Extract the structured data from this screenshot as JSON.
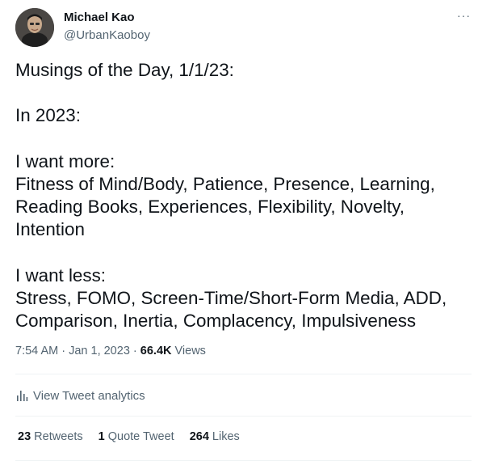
{
  "author": {
    "name": "Michael Kao",
    "handle": "@UrbanKaoboy"
  },
  "more_label": "···",
  "tweet": {
    "lines": [
      "Musings of the Day, 1/1/23:",
      "",
      "In 2023:",
      "",
      "I want more:",
      "Fitness of Mind/Body, Patience, Presence, Learning,",
      "Reading Books, Experiences, Flexibility, Novelty,",
      "Intention",
      "",
      "I want less:",
      "Stress, FOMO, Screen-Time/Short-Form Media, ADD,",
      "Comparison, Inertia, Complacency, Impulsiveness"
    ]
  },
  "meta": {
    "time": "7:54 AM",
    "sep1": " · ",
    "date": "Jan 1, 2023",
    "sep2": " · ",
    "views_count": "66.4K",
    "views_label": " Views"
  },
  "analytics": {
    "label": "View Tweet analytics",
    "icon": "analytics-bar-icon"
  },
  "stats": {
    "retweets_count": "23",
    "retweets_label": " Retweets",
    "quotes_count": "1",
    "quotes_label": " Quote Tweet",
    "likes_count": "264",
    "likes_label": " Likes"
  },
  "colors": {
    "text_primary": "#0f1419",
    "text_secondary": "#536471",
    "divider": "#eff3f4"
  }
}
